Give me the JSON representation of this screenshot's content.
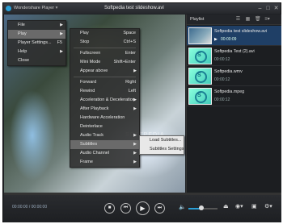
{
  "titlebar": {
    "app_name": "Wondershare Player",
    "title": "Softpedia test slideshow.avi"
  },
  "main_menu": [
    {
      "label": "File",
      "submenu": true
    },
    {
      "label": "Play",
      "submenu": true,
      "active": true
    },
    {
      "label": "Player Settings...",
      "shortcut": "F5"
    },
    {
      "label": "Help",
      "submenu": true
    },
    {
      "label": "Close"
    }
  ],
  "play_menu": [
    {
      "label": "Play",
      "shortcut": "Space"
    },
    {
      "label": "Stop",
      "shortcut": "Ctrl+S"
    },
    {
      "sep": true
    },
    {
      "label": "Fullscreen",
      "shortcut": "Enter"
    },
    {
      "label": "Mini Mode",
      "shortcut": "Shift+Enter"
    },
    {
      "label": "Appear above",
      "submenu": true
    },
    {
      "sep": true
    },
    {
      "label": "Forward",
      "shortcut": "Right"
    },
    {
      "label": "Rewind",
      "shortcut": "Left"
    },
    {
      "label": "Acceleration & Deceleration",
      "submenu": true
    },
    {
      "label": "After Playback",
      "submenu": true
    },
    {
      "label": "Hardware Acceleration"
    },
    {
      "label": "Deinterlace"
    },
    {
      "label": "Audio Track",
      "submenu": true
    },
    {
      "label": "Subtitles",
      "submenu": true,
      "active": true
    },
    {
      "label": "Audio Channel",
      "submenu": true
    },
    {
      "label": "Frame",
      "submenu": true
    }
  ],
  "subtitles_menu": [
    {
      "label": "Load Subtitles..."
    },
    {
      "label": "Subtitles Settings"
    }
  ],
  "watermark": "SOFTPEDIA",
  "playlist": {
    "title": "Playlist",
    "items": [
      {
        "name": "Softpedia test slideshow.avi",
        "duration": "00:00:09",
        "active": true,
        "thumb": "video"
      },
      {
        "name": "Softpedia Test (2).avi",
        "duration": "00:00:12",
        "thumb_text": "S"
      },
      {
        "name": "Softpedia.wmv",
        "duration": "00:00:12",
        "thumb_text": "S"
      },
      {
        "name": "Softpedia.mpeg",
        "duration": "00:00:12",
        "thumb_text": "S"
      }
    ]
  },
  "playback": {
    "time": "00:00:00 / 00:00:00",
    "progress": 0.0,
    "volume": 0.45
  },
  "colors": {
    "accent": "#2a9fd6",
    "active_row": "#1f3f66",
    "background": "#202226"
  },
  "icons": {
    "stop": "stop-icon",
    "prev": "previous-icon",
    "play": "play-icon",
    "next": "next-icon",
    "volume": "speaker-icon",
    "eject": "eject-icon",
    "screenshot": "camera-icon",
    "fullscreen": "fullscreen-icon",
    "settings": "settings-icon"
  }
}
